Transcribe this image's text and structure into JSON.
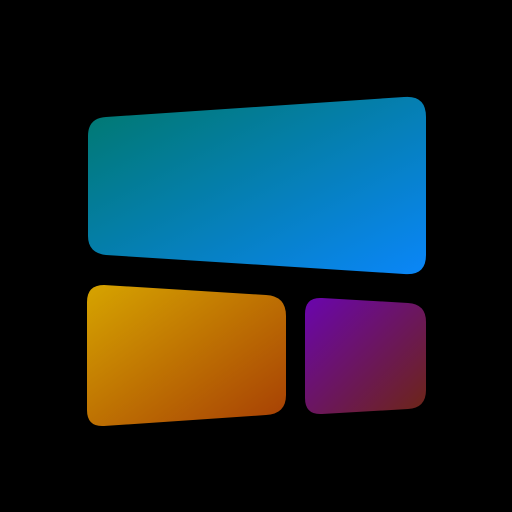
{
  "app_icon": {
    "icon_name": "widget-layout-icon",
    "background": "#000000",
    "tiles": [
      {
        "name": "top-tile",
        "gradient_start": "#00786C",
        "gradient_end": "#0A86F8"
      },
      {
        "name": "bottom-left-tile",
        "gradient_start": "#D6A400",
        "gradient_end": "#A63E05"
      },
      {
        "name": "bottom-right-tile",
        "gradient_start": "#6A05AE",
        "gradient_end": "#6C2614"
      }
    ]
  }
}
